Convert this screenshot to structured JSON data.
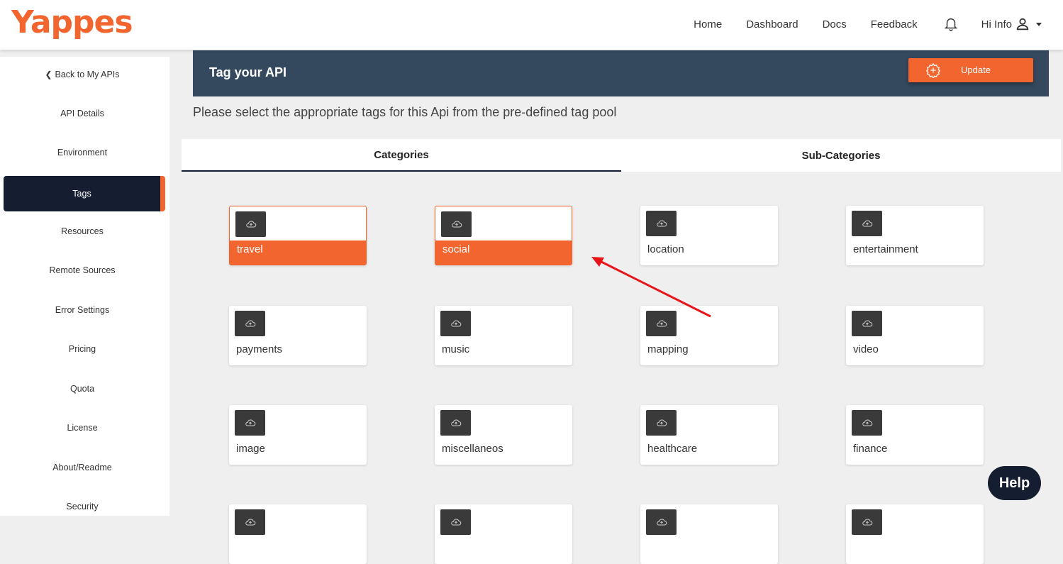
{
  "brand": {
    "logo_text": "Yappes",
    "accent": "#f2652f",
    "dark": "#141e30"
  },
  "nav": {
    "links": [
      "Home",
      "Dashboard",
      "Docs",
      "Feedback"
    ],
    "user_greeting": "Hi Info",
    "bell_icon": "bell-icon",
    "user_icon": "user-icon"
  },
  "sidebar": {
    "back_label": "Back to My APIs",
    "items": [
      "API Details",
      "Environment",
      "Tags",
      "Resources",
      "Remote Sources",
      "Error Settings",
      "Pricing",
      "Quota",
      "License",
      "About/Readme",
      "Security"
    ],
    "active_item": "Tags"
  },
  "header": {
    "title": "Tag your API",
    "update_label": "Update"
  },
  "subtitle": "Please select the appropriate tags for this Api from the pre-defined tag pool",
  "tabs": [
    "Categories",
    "Sub-Categories"
  ],
  "active_tab": "Categories",
  "tags": [
    {
      "label": "travel",
      "selected": true
    },
    {
      "label": "social",
      "selected": true
    },
    {
      "label": "location",
      "selected": false
    },
    {
      "label": "entertainment",
      "selected": false
    },
    {
      "label": "payments",
      "selected": false
    },
    {
      "label": "music",
      "selected": false
    },
    {
      "label": "mapping",
      "selected": false
    },
    {
      "label": "video",
      "selected": false
    },
    {
      "label": "image",
      "selected": false
    },
    {
      "label": "miscellaneos",
      "selected": false
    },
    {
      "label": "healthcare",
      "selected": false
    },
    {
      "label": "finance",
      "selected": false
    },
    {
      "label": "",
      "selected": false
    },
    {
      "label": "",
      "selected": false
    },
    {
      "label": "",
      "selected": false
    },
    {
      "label": "",
      "selected": false
    }
  ],
  "help_label": "Help"
}
